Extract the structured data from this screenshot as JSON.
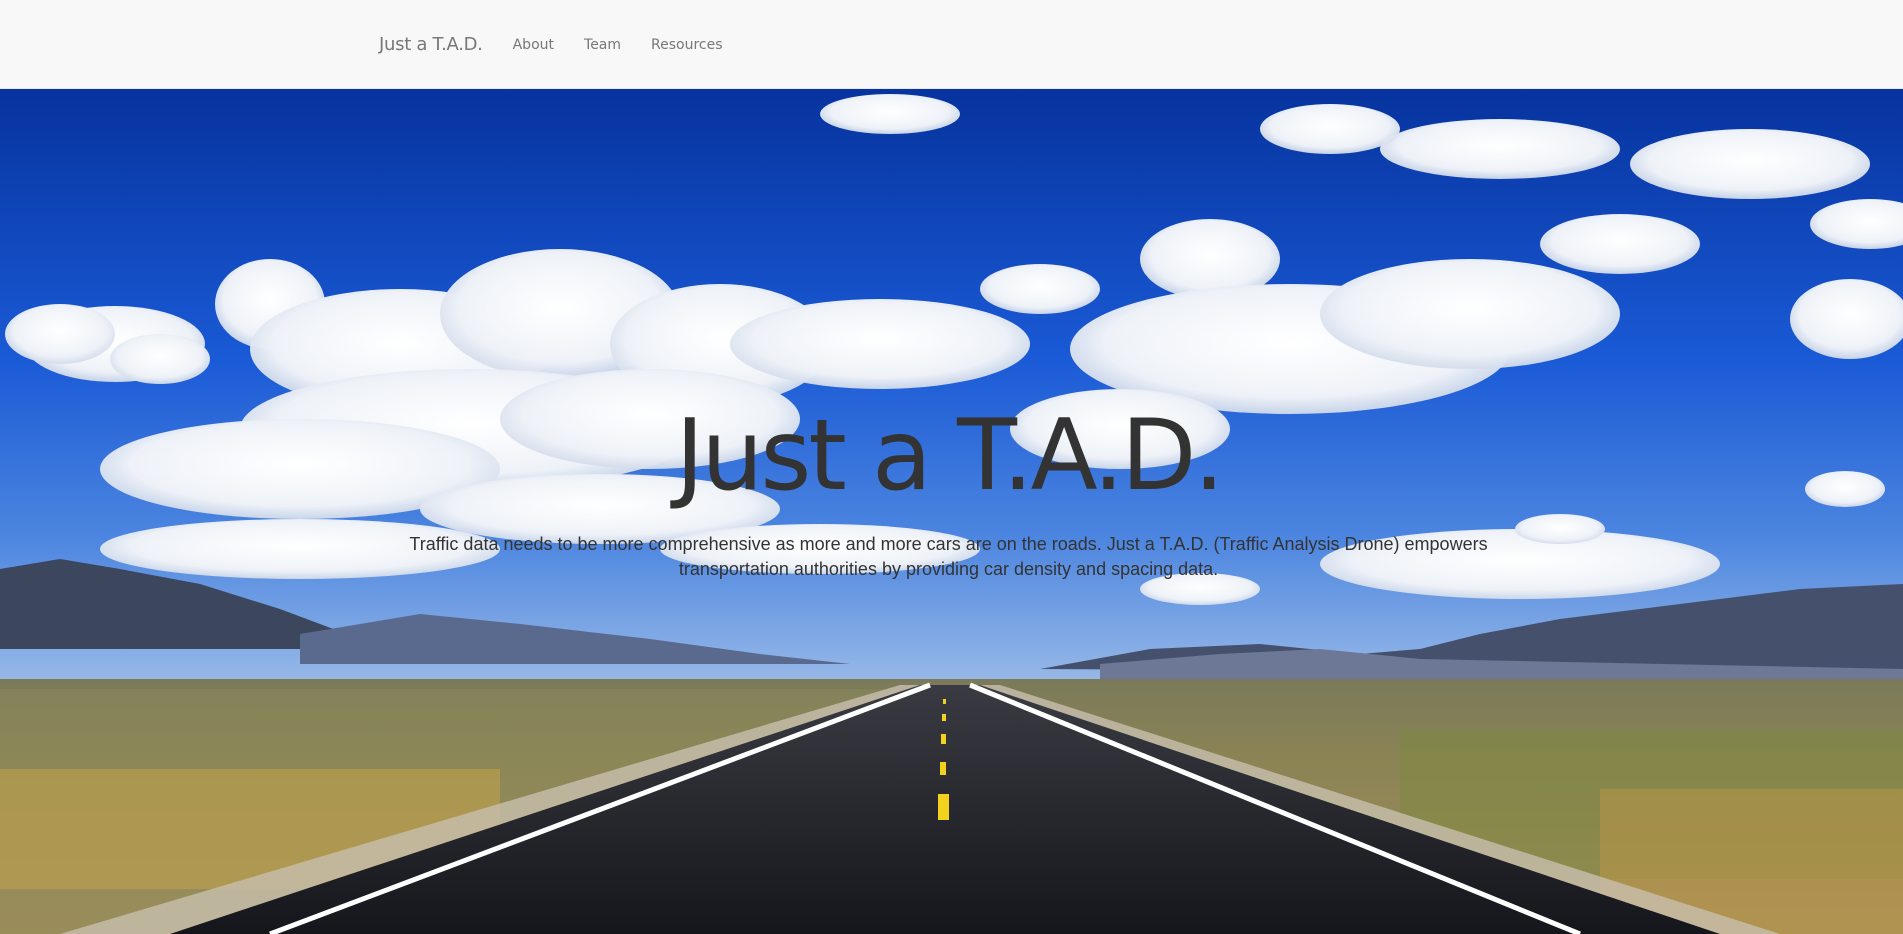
{
  "navbar": {
    "brand": "Just a T.A.D.",
    "links": [
      {
        "label": "About"
      },
      {
        "label": "Team"
      },
      {
        "label": "Resources"
      }
    ]
  },
  "hero": {
    "title": "Just a T.A.D.",
    "description": "Traffic data needs to be more comprehensive as more and more cars are on the roads. Just a T.A.D. (Traffic Analysis Drone) empowers transportation authorities by providing car density and spacing data."
  },
  "colors": {
    "navbar_bg": "#f8f8f8",
    "nav_text": "#777777",
    "hero_text": "#333333",
    "sky_top": "#06339e",
    "road": "#1c1d22",
    "lane_marking": "#f2d21c"
  }
}
